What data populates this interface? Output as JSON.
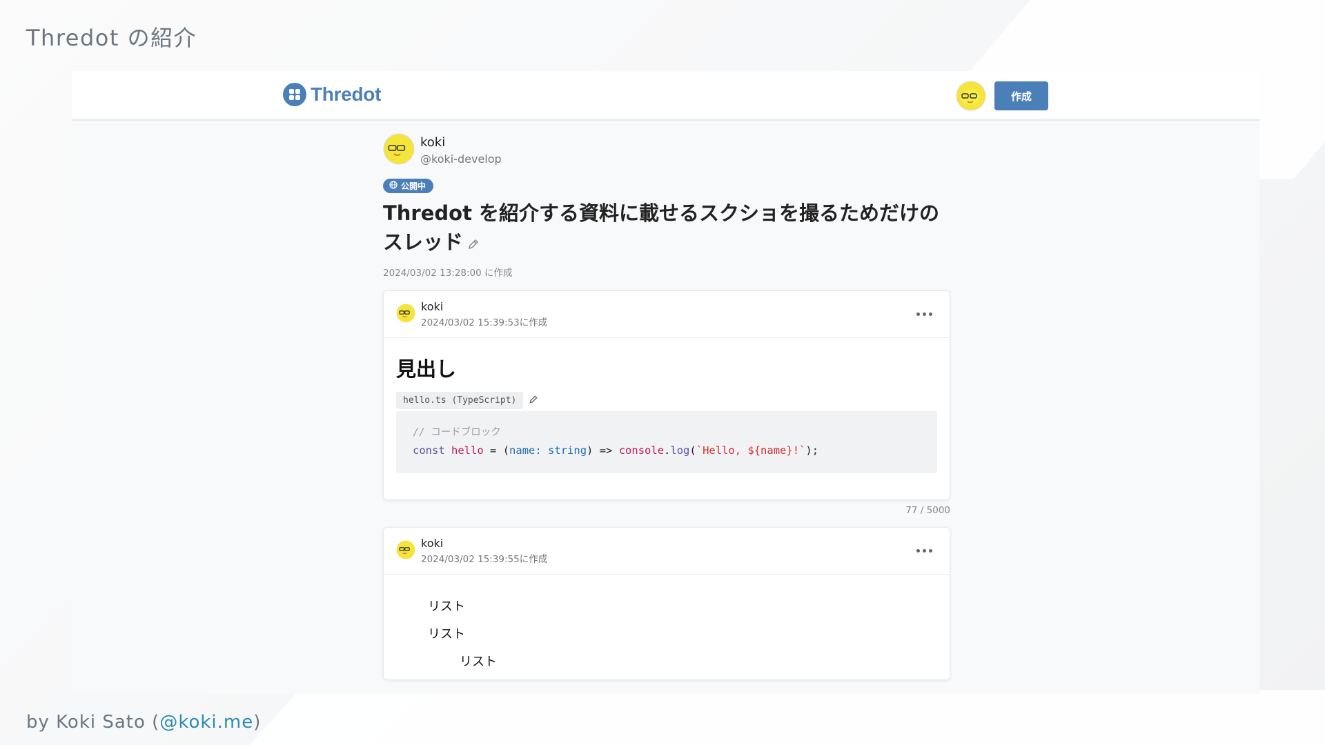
{
  "slide": {
    "title": "Thredot の紹介",
    "footer_prefix": "by Koki Sato (",
    "footer_link": "@koki.me",
    "footer_suffix": ")"
  },
  "app": {
    "brand": "Thredot",
    "brand_color": "#4a7fb8",
    "create_button": "作成"
  },
  "thread": {
    "author_name": "koki",
    "author_handle": "@koki-develop",
    "visibility_badge": "公開中",
    "title": "Threadot を紹介する資料に載せるスクショを撮るためだけのスレッド",
    "title_display": "Thredot を紹介する資料に載せるスクショを撮るためだけのスレッド",
    "created_at": "2024/03/02 13:28:00 に作成"
  },
  "posts": [
    {
      "user": "koki",
      "time": "2024/03/02 15:39:53に作成",
      "heading": "見出し",
      "file_label": "hello.ts (TypeScript)",
      "code_comment": "// コードブロック",
      "counter": "77 / 5000"
    },
    {
      "user": "koki",
      "time": "2024/03/02 15:39:55に作成",
      "list_items": [
        "リスト",
        "リスト"
      ],
      "nested_items": [
        "リスト"
      ]
    }
  ]
}
